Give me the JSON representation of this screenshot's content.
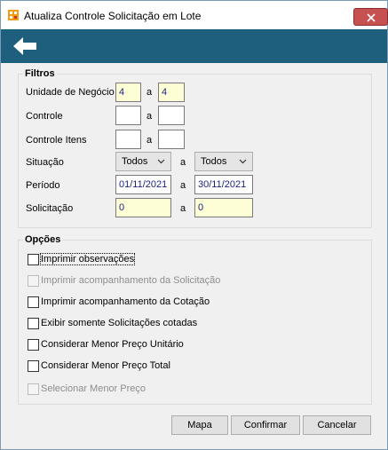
{
  "window": {
    "title": "Atualiza Controle Solicitação em Lote"
  },
  "filters": {
    "title": "Filtros",
    "range_separator": "a",
    "unidade": {
      "label": "Unidade de Negócio",
      "from": "4",
      "to": "4"
    },
    "controle": {
      "label": "Controle",
      "from": "",
      "to": ""
    },
    "controle_itens": {
      "label": "Controle Itens",
      "from": "",
      "to": ""
    },
    "situacao": {
      "label": "Situação",
      "from": "Todos",
      "to": "Todos"
    },
    "periodo": {
      "label": "Período",
      "from": "01/11/2021",
      "to": "30/11/2021"
    },
    "solicitacao": {
      "label": "Solicitação",
      "from": "0",
      "to": "0"
    }
  },
  "options": {
    "title": "Opções",
    "items": [
      {
        "label": "Imprimir observações",
        "checked": false,
        "enabled": true
      },
      {
        "label": "Imprimir acompanhamento da Solicitação",
        "checked": false,
        "enabled": false
      },
      {
        "label": "Imprimir acompanhamento da Cotação",
        "checked": false,
        "enabled": true
      },
      {
        "label": "Exibir somente Solicitações cotadas",
        "checked": false,
        "enabled": true
      },
      {
        "label": "Considerar Menor Preço Unitário",
        "checked": false,
        "enabled": true
      },
      {
        "label": "Considerar Menor Preço Total",
        "checked": false,
        "enabled": true
      },
      {
        "label": "Selecionar Menor Preço",
        "checked": false,
        "enabled": false
      }
    ]
  },
  "buttons": {
    "mapa": "Mapa",
    "confirmar": "Confirmar",
    "cancelar": "Cancelar"
  },
  "colors": {
    "toolbar": "#1f5f7e",
    "close": "#c75050",
    "highlight_field": "#fefed6"
  }
}
